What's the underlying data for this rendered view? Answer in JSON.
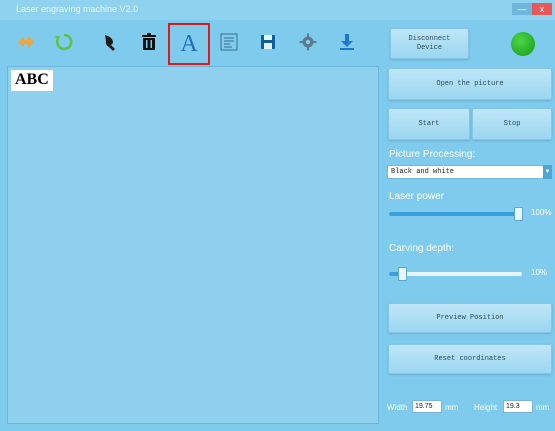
{
  "window": {
    "title": "Laser engraving machine V2.0",
    "minimize": "—",
    "close": "x"
  },
  "toolbar": {
    "tools": [
      {
        "icon": "flip-arrows-icon"
      },
      {
        "icon": "rotate-icon"
      },
      {
        "icon": "brush-icon"
      },
      {
        "icon": "trash-icon"
      },
      {
        "icon": "text-icon",
        "glyph": "A",
        "selected": true
      },
      {
        "icon": "text-layout-icon"
      },
      {
        "icon": "save-icon"
      },
      {
        "icon": "gear-icon"
      },
      {
        "icon": "download-icon"
      }
    ],
    "connection_button": "Disconnect\nDevice"
  },
  "canvas": {
    "text": "ABC"
  },
  "panel": {
    "open_picture": "Open the picture",
    "start": "Start",
    "stop": "Stop",
    "picture_processing_label": "Picture Processing:",
    "picture_processing_value": "Black and white",
    "laser_power_label": "Laser power",
    "laser_power_value": "100%",
    "laser_power_fraction": 1.0,
    "carving_depth_label": "Carving depth:",
    "carving_depth_value": "10%",
    "carving_depth_fraction": 0.1,
    "preview_position": "Preview Position",
    "reset_coordinates": "Reset coordinates",
    "width_label": "Width",
    "width_value": "19.75",
    "width_unit": "mm",
    "height_label": "Height",
    "height_value": "19.3",
    "height_unit": "mm"
  },
  "colors": {
    "background": "#7ecbed",
    "status": "#2ab42a",
    "selection": "#e01a1a"
  }
}
